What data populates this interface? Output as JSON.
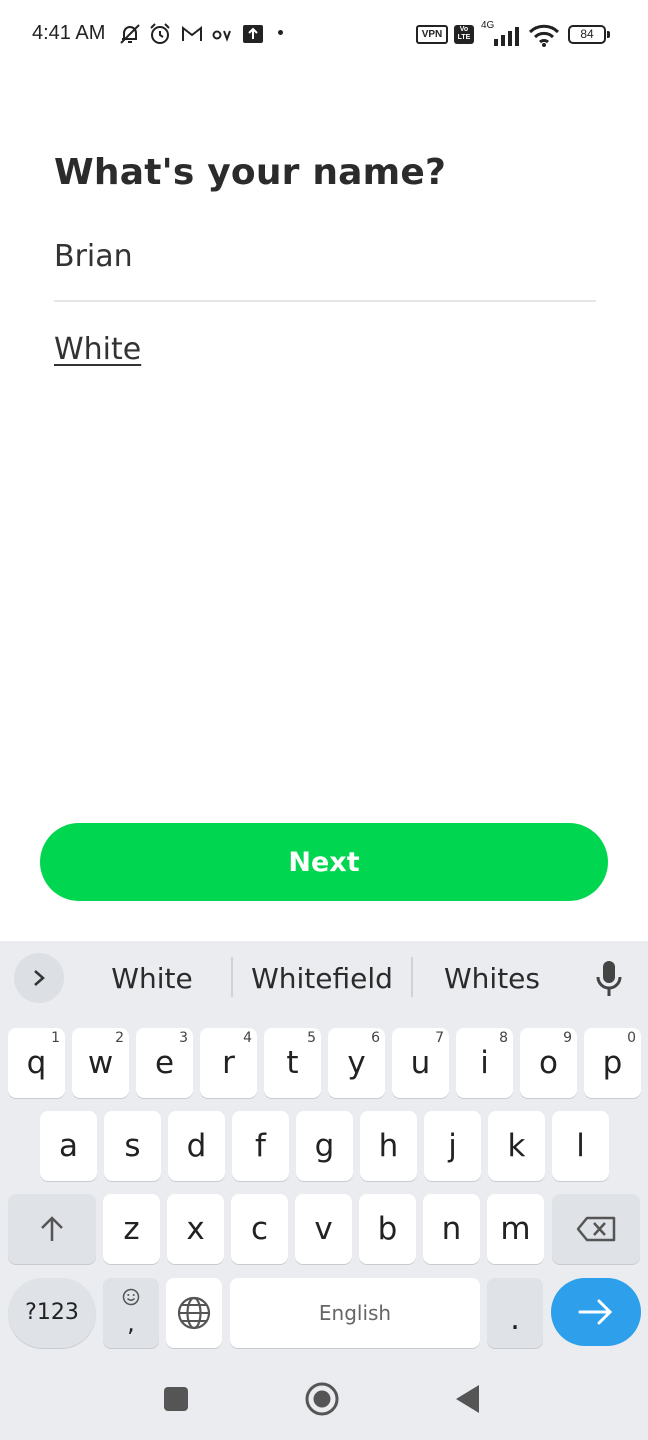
{
  "status_bar": {
    "time": "4:41 AM",
    "icons": [
      "mute-bell-icon",
      "alarm-icon",
      "gmail-icon",
      "av-icon",
      "upload-icon"
    ],
    "vpn_label": "VPN",
    "volte_label": "Vo LTE",
    "network_label": "4G",
    "battery_level": "84"
  },
  "form": {
    "title": "What's your name?",
    "first_name": "Brian",
    "last_name": "White"
  },
  "next_button": {
    "label": "Next",
    "color": "#00d64f"
  },
  "keyboard": {
    "suggestions": [
      "White",
      "Whitefield",
      "Whites"
    ],
    "row1": [
      {
        "key": "q",
        "hint": "1"
      },
      {
        "key": "w",
        "hint": "2"
      },
      {
        "key": "e",
        "hint": "3"
      },
      {
        "key": "r",
        "hint": "4"
      },
      {
        "key": "t",
        "hint": "5"
      },
      {
        "key": "y",
        "hint": "6"
      },
      {
        "key": "u",
        "hint": "7"
      },
      {
        "key": "i",
        "hint": "8"
      },
      {
        "key": "o",
        "hint": "9"
      },
      {
        "key": "p",
        "hint": "0"
      }
    ],
    "row2": [
      "a",
      "s",
      "d",
      "f",
      "g",
      "h",
      "j",
      "k",
      "l"
    ],
    "row3": [
      "z",
      "x",
      "c",
      "v",
      "b",
      "n",
      "m"
    ],
    "symbols_label": "?123",
    "comma_label": ",",
    "space_label": "English",
    "period_label": ".",
    "enter_color": "#2e9fea"
  },
  "nav_bar": {
    "buttons": [
      "recents-button",
      "home-button",
      "back-button"
    ]
  }
}
